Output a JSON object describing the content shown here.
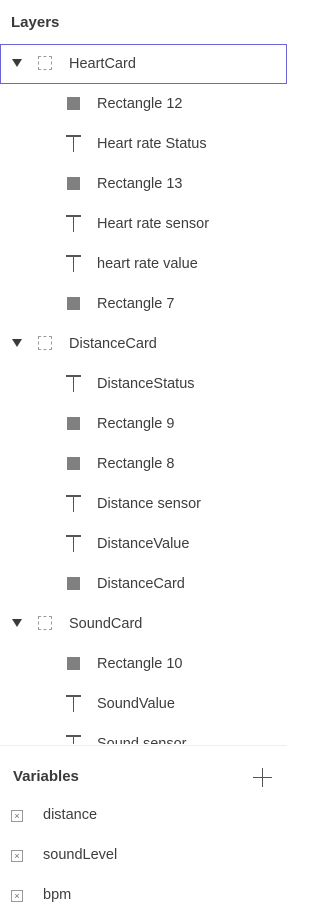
{
  "layers": {
    "title": "Layers",
    "groups": [
      {
        "label": "HeartCard",
        "selected": true,
        "children": [
          {
            "type": "rect",
            "label": "Rectangle 12"
          },
          {
            "type": "text",
            "label": "Heart rate Status"
          },
          {
            "type": "rect",
            "label": "Rectangle 13"
          },
          {
            "type": "text",
            "label": "Heart rate sensor"
          },
          {
            "type": "text",
            "label": "heart rate value"
          },
          {
            "type": "rect",
            "label": "Rectangle 7"
          }
        ]
      },
      {
        "label": "DistanceCard",
        "selected": false,
        "children": [
          {
            "type": "text",
            "label": "DistanceStatus"
          },
          {
            "type": "rect",
            "label": "Rectangle 9"
          },
          {
            "type": "rect",
            "label": "Rectangle 8"
          },
          {
            "type": "text",
            "label": "Distance sensor"
          },
          {
            "type": "text",
            "label": "DistanceValue"
          },
          {
            "type": "rect",
            "label": "DistanceCard"
          }
        ]
      },
      {
        "label": "SoundCard",
        "selected": false,
        "children": [
          {
            "type": "rect",
            "label": "Rectangle 10"
          },
          {
            "type": "text",
            "label": "SoundValue"
          },
          {
            "type": "text",
            "label": "Sound sensor"
          }
        ]
      }
    ]
  },
  "variables": {
    "title": "Variables",
    "add_icon": "plus-icon",
    "items": [
      {
        "label": "distance"
      },
      {
        "label": "soundLevel"
      },
      {
        "label": "bpm"
      }
    ]
  }
}
